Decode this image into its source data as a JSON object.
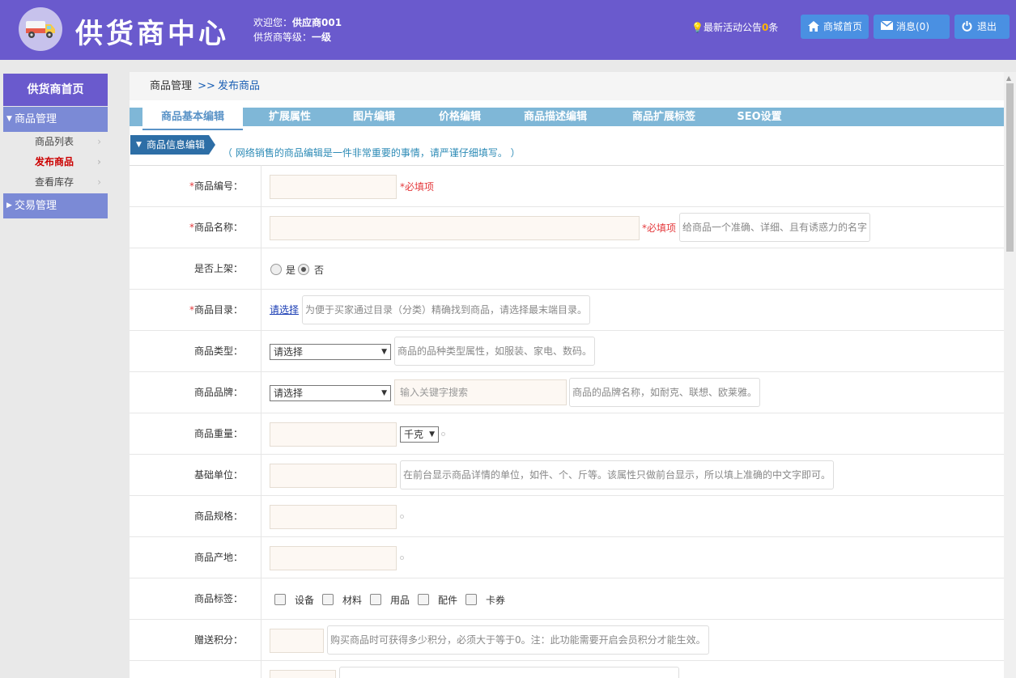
{
  "header": {
    "brand": "供货商中心",
    "welcome_prefix": "欢迎您：",
    "welcome_name": "供应商001",
    "level_prefix": "供货商等级：",
    "level": "一级",
    "notice_label": "最新活动公告",
    "notice_count": "0",
    "notice_unit": "条",
    "buttons": {
      "mall_home": "商城首页",
      "messages": "消息(0)",
      "logout": "退出"
    }
  },
  "sidebar": {
    "home": "供货商首页",
    "groups": [
      {
        "label": "商品管理",
        "items": [
          {
            "label": "商品列表"
          },
          {
            "label": "发布商品"
          },
          {
            "label": "查看库存"
          }
        ]
      },
      {
        "label": "交易管理"
      }
    ]
  },
  "breadcrumb": {
    "parent": "商品管理",
    "sep": ">>",
    "current": "发布商品"
  },
  "tabs": [
    "商品基本编辑",
    "扩展属性",
    "图片编辑",
    "价格编辑",
    "商品描述编辑",
    "商品扩展标签",
    "SEO设置"
  ],
  "section": {
    "title": "商品信息编辑",
    "hint": "（ 网络销售的商品编辑是一件非常重要的事情，请严谨仔细填写。 ）"
  },
  "form": {
    "required_mark": "*",
    "required_text": "*必填项",
    "code_label": "商品编号：",
    "name_label": "商品名称：",
    "name_tip": "给商品一个准确、详细、且有诱惑力的名字",
    "onsale_label": "是否上架：",
    "onsale_yes": "是",
    "onsale_no": "否",
    "category_label": "商品目录：",
    "category_link": "请选择",
    "category_tip": "为便于买家通过目录（分类）精确找到商品，请选择最末端目录。",
    "type_label": "商品类型：",
    "type_value": "请选择",
    "type_tip": "商品的品种类型属性，如服装、家电、数码。",
    "brand_label": "商品品牌：",
    "brand_value": "请选择",
    "brand_placeholder": "输入关键字搜索",
    "brand_tip": "商品的品牌名称，如耐克、联想、欧莱雅。",
    "weight_label": "商品重量：",
    "weight_unit": "千克",
    "unit_label": "基础单位：",
    "unit_tip": "在前台显示商品详情的单位，如件、个、斤等。该属性只做前台显示，所以填上准确的中文字即可。",
    "spec_label": "商品规格：",
    "origin_label": "商品产地：",
    "tags_label": "商品标签：",
    "tags": [
      "设备",
      "材料",
      "用品",
      "配件",
      "卡券"
    ],
    "points_label": "赠送积分：",
    "points_tip": "购买商品时可获得多少积分，必须大于等于0。注：此功能需要开启会员积分才能生效。"
  }
}
